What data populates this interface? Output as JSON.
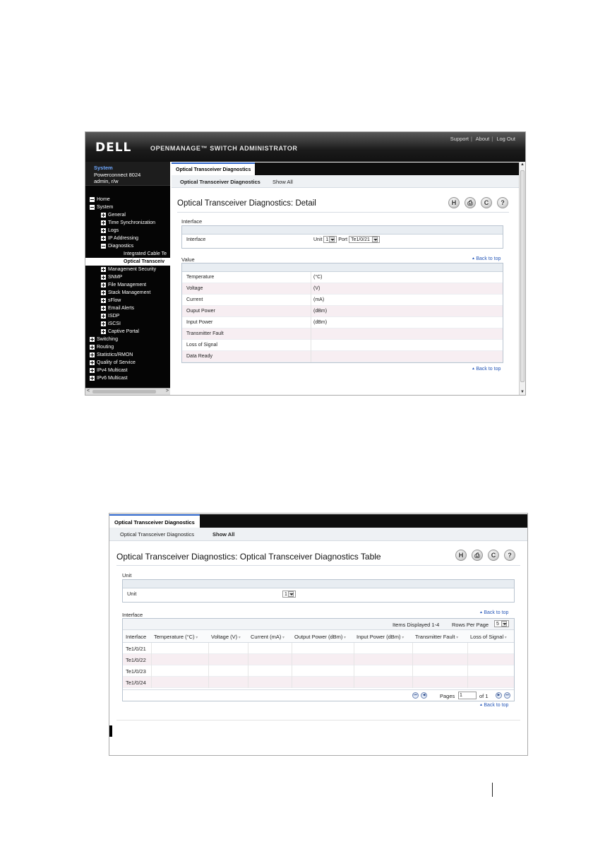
{
  "detail": {
    "logo": "DELL",
    "app_title": "OPENMANAGE™ SWITCH ADMINISTRATOR",
    "top_links": [
      "Support",
      "About",
      "Log Out"
    ],
    "system": {
      "title": "System",
      "model": "Powerconnect 8024",
      "user": "admin, r/w"
    },
    "tree": [
      {
        "label": "Home",
        "level": 0,
        "icon": "minus"
      },
      {
        "label": "System",
        "level": 0,
        "icon": "minus"
      },
      {
        "label": "General",
        "level": 1,
        "icon": "plus"
      },
      {
        "label": "Time Synchronization",
        "level": 1,
        "icon": "plus"
      },
      {
        "label": "Logs",
        "level": 1,
        "icon": "plus"
      },
      {
        "label": "IP Addressing",
        "level": 1,
        "icon": "plus"
      },
      {
        "label": "Diagnostics",
        "level": 1,
        "icon": "minus"
      },
      {
        "label": "Integrated Cable Te",
        "level": 2,
        "icon": "none"
      },
      {
        "label": "Optical Transceiv",
        "level": 2,
        "icon": "none",
        "selected": true
      },
      {
        "label": "Management Security",
        "level": 1,
        "icon": "plus"
      },
      {
        "label": "SNMP",
        "level": 1,
        "icon": "plus"
      },
      {
        "label": "File Management",
        "level": 1,
        "icon": "plus"
      },
      {
        "label": "Stack Management",
        "level": 1,
        "icon": "plus"
      },
      {
        "label": "sFlow",
        "level": 1,
        "icon": "plus"
      },
      {
        "label": "Email Alerts",
        "level": 1,
        "icon": "plus"
      },
      {
        "label": "ISDP",
        "level": 1,
        "icon": "plus"
      },
      {
        "label": "iSCSI",
        "level": 1,
        "icon": "plus"
      },
      {
        "label": "Captive Portal",
        "level": 1,
        "icon": "plus"
      },
      {
        "label": "Switching",
        "level": 0,
        "icon": "plus"
      },
      {
        "label": "Routing",
        "level": 0,
        "icon": "plus"
      },
      {
        "label": "Statistics/RMON",
        "level": 0,
        "icon": "plus"
      },
      {
        "label": "Quality of Service",
        "level": 0,
        "icon": "plus"
      },
      {
        "label": "IPv4 Multicast",
        "level": 0,
        "icon": "plus"
      },
      {
        "label": "IPv6 Multicast",
        "level": 0,
        "icon": "plus"
      }
    ],
    "tab_label": "Optical Transceiver Diagnostics",
    "sub_tabs": [
      "Optical Transceiver Diagnostics",
      "Show All"
    ],
    "page_title": "Optical Transceiver Diagnostics: Detail",
    "icon_glyphs": {
      "save": "H",
      "print": "⎙",
      "refresh": "C",
      "help": "?"
    },
    "interface_section": "Interface",
    "interface_row": {
      "label": "Interface",
      "unit_label": "Unit",
      "unit_value": "1",
      "port_label": "Port",
      "port_value": "Te1/0/21"
    },
    "value_section": "Value",
    "back_to_top": "Back to top",
    "values": [
      {
        "name": "Temperature",
        "unit": "(°C)"
      },
      {
        "name": "Voltage",
        "unit": "(V)"
      },
      {
        "name": "Current",
        "unit": "(mA)"
      },
      {
        "name": "Ouput Power",
        "unit": "(dBm)"
      },
      {
        "name": "Input Power",
        "unit": "(dBm)"
      },
      {
        "name": "Transmitter Fault",
        "unit": ""
      },
      {
        "name": "Loss of Signal",
        "unit": ""
      },
      {
        "name": "Data Ready",
        "unit": ""
      }
    ]
  },
  "table_view": {
    "tab_label": "Optical Transceiver Diagnostics",
    "sub_tabs": [
      "Optical Transceiver Diagnostics",
      "Show All"
    ],
    "page_title": "Optical Transceiver Diagnostics: Optical Transceiver Diagnostics Table",
    "icon_glyphs": {
      "save": "H",
      "print": "⎙",
      "refresh": "C",
      "help": "?"
    },
    "unit_section": "Unit",
    "unit_row": {
      "label": "Unit",
      "value": "1"
    },
    "interface_section": "Interface",
    "back_to_top": "Back to top",
    "items_displayed": "Items Displayed 1-4",
    "rows_per_page_label": "Rows Per Page",
    "rows_per_page_value": "5",
    "columns": [
      "Interface",
      "Temperature (°C)",
      "Voltage (V)",
      "Current (mA)",
      "Output Power (dBm)",
      "Input Power (dBm)",
      "Transmitter Fault",
      "Loss of Signal"
    ],
    "rows": [
      "Te1/0/21",
      "Te1/0/22",
      "Te1/0/23",
      "Te1/0/24"
    ],
    "pages_label": "Pages",
    "page_value": "1",
    "of_label": "of 1"
  }
}
